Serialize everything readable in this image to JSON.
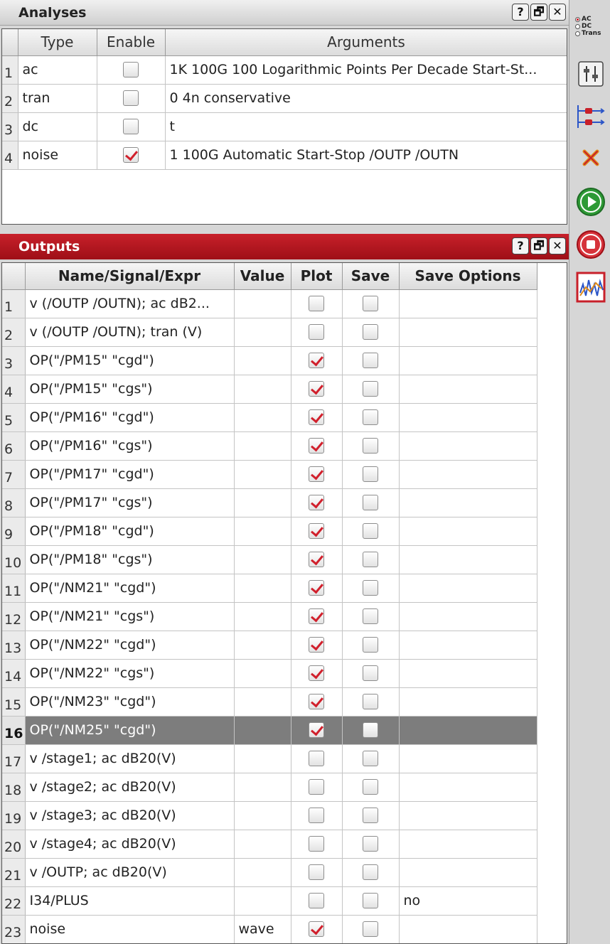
{
  "analyses": {
    "title": "Analyses",
    "columns": [
      "Type",
      "Enable",
      "Arguments"
    ],
    "rows": [
      {
        "num": "1",
        "type": "ac",
        "enabled": false,
        "args": "1K 100G 100 Logarithmic Points Per Decade Start-St..."
      },
      {
        "num": "2",
        "type": "tran",
        "enabled": false,
        "args": "0 4n conservative"
      },
      {
        "num": "3",
        "type": "dc",
        "enabled": false,
        "args": "t"
      },
      {
        "num": "4",
        "type": "noise",
        "enabled": true,
        "args": "1 100G Automatic Start-Stop /OUTP /OUTN"
      }
    ]
  },
  "outputs": {
    "title": "Outputs",
    "columns": [
      "Name/Signal/Expr",
      "Value",
      "Plot",
      "Save",
      "Save Options"
    ],
    "selected_row": "16",
    "rows": [
      {
        "num": "1",
        "name": "v (/OUTP /OUTN); ac dB2...",
        "value": "",
        "plot": false,
        "save": false,
        "options": ""
      },
      {
        "num": "2",
        "name": "v (/OUTP /OUTN); tran (V)",
        "value": "",
        "plot": false,
        "save": false,
        "options": ""
      },
      {
        "num": "3",
        "name": "OP(\"/PM15\" \"cgd\")",
        "value": "",
        "plot": true,
        "save": false,
        "options": ""
      },
      {
        "num": "4",
        "name": "OP(\"/PM15\" \"cgs\")",
        "value": "",
        "plot": true,
        "save": false,
        "options": ""
      },
      {
        "num": "5",
        "name": "OP(\"/PM16\" \"cgd\")",
        "value": "",
        "plot": true,
        "save": false,
        "options": ""
      },
      {
        "num": "6",
        "name": "OP(\"/PM16\" \"cgs\")",
        "value": "",
        "plot": true,
        "save": false,
        "options": ""
      },
      {
        "num": "7",
        "name": "OP(\"/PM17\" \"cgd\")",
        "value": "",
        "plot": true,
        "save": false,
        "options": ""
      },
      {
        "num": "8",
        "name": "OP(\"/PM17\" \"cgs\")",
        "value": "",
        "plot": true,
        "save": false,
        "options": ""
      },
      {
        "num": "9",
        "name": "OP(\"/PM18\" \"cgd\")",
        "value": "",
        "plot": true,
        "save": false,
        "options": ""
      },
      {
        "num": "10",
        "name": "OP(\"/PM18\" \"cgs\")",
        "value": "",
        "plot": true,
        "save": false,
        "options": ""
      },
      {
        "num": "11",
        "name": "OP(\"/NM21\" \"cgd\")",
        "value": "",
        "plot": true,
        "save": false,
        "options": ""
      },
      {
        "num": "12",
        "name": "OP(\"/NM21\" \"cgs\")",
        "value": "",
        "plot": true,
        "save": false,
        "options": ""
      },
      {
        "num": "13",
        "name": "OP(\"/NM22\" \"cgd\")",
        "value": "",
        "plot": true,
        "save": false,
        "options": ""
      },
      {
        "num": "14",
        "name": "OP(\"/NM22\" \"cgs\")",
        "value": "",
        "plot": true,
        "save": false,
        "options": ""
      },
      {
        "num": "15",
        "name": "OP(\"/NM23\" \"cgd\")",
        "value": "",
        "plot": true,
        "save": false,
        "options": ""
      },
      {
        "num": "16",
        "name": "OP(\"/NM25\" \"cgd\")",
        "value": "",
        "plot": true,
        "save": false,
        "options": ""
      },
      {
        "num": "17",
        "name": "v /stage1; ac dB20(V)",
        "value": "",
        "plot": false,
        "save": false,
        "options": ""
      },
      {
        "num": "18",
        "name": "v /stage2; ac dB20(V)",
        "value": "",
        "plot": false,
        "save": false,
        "options": ""
      },
      {
        "num": "19",
        "name": "v /stage3; ac dB20(V)",
        "value": "",
        "plot": false,
        "save": false,
        "options": ""
      },
      {
        "num": "20",
        "name": "v /stage4; ac dB20(V)",
        "value": "",
        "plot": false,
        "save": false,
        "options": ""
      },
      {
        "num": "21",
        "name": "v /OUTP; ac dB20(V)",
        "value": "",
        "plot": false,
        "save": false,
        "options": ""
      },
      {
        "num": "22",
        "name": "I34/PLUS",
        "value": "",
        "plot": false,
        "save": false,
        "options": "no"
      },
      {
        "num": "23",
        "name": "noise",
        "value": "wave",
        "plot": true,
        "save": false,
        "options": ""
      }
    ]
  },
  "panel_buttons": {
    "help": "?",
    "float": "🗗",
    "close": "✕"
  },
  "toolbar": {
    "sim_modes": [
      {
        "label": "AC",
        "selected": true
      },
      {
        "label": "DC",
        "selected": false
      },
      {
        "label": "Trans",
        "selected": false
      }
    ],
    "icons": [
      "tune-icon",
      "netlist-icon",
      "delete-icon",
      "run-icon",
      "stop-icon",
      "waveform-icon"
    ]
  },
  "colors": {
    "accent": "#c8202a",
    "check": "#d1202c",
    "selected_row": "#7d7d7d",
    "run": "#2e9a36"
  }
}
